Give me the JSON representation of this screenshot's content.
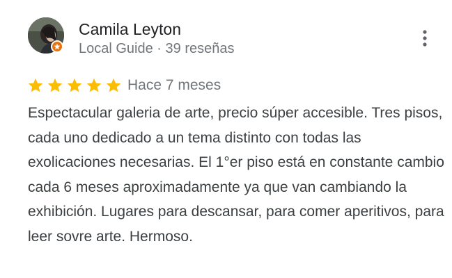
{
  "reviewer": {
    "name": "Camila Leyton",
    "meta": "Local Guide · 39 reseñas",
    "avatar_icon": "profile-photo",
    "badge_icon": "local-guide-badge-icon",
    "badge_color": "#e8710a"
  },
  "review": {
    "rating": 5,
    "max_rating": 5,
    "star_color": "#fbbc04",
    "date": "Hace 7 meses",
    "text": "Espectacular galeria de arte, precio súper accesible. Tres pisos, cada uno dedicado a un tema distinto con todas las exolicaciones necesarias. El 1°er piso está en constante cambio cada 6 meses aproximadamente ya que van cambiando la exhibición. Lugares para descansar, para comer aperitivos, para leer sovre arte. Hermoso."
  },
  "actions": {
    "more_icon": "more-vert-icon"
  }
}
